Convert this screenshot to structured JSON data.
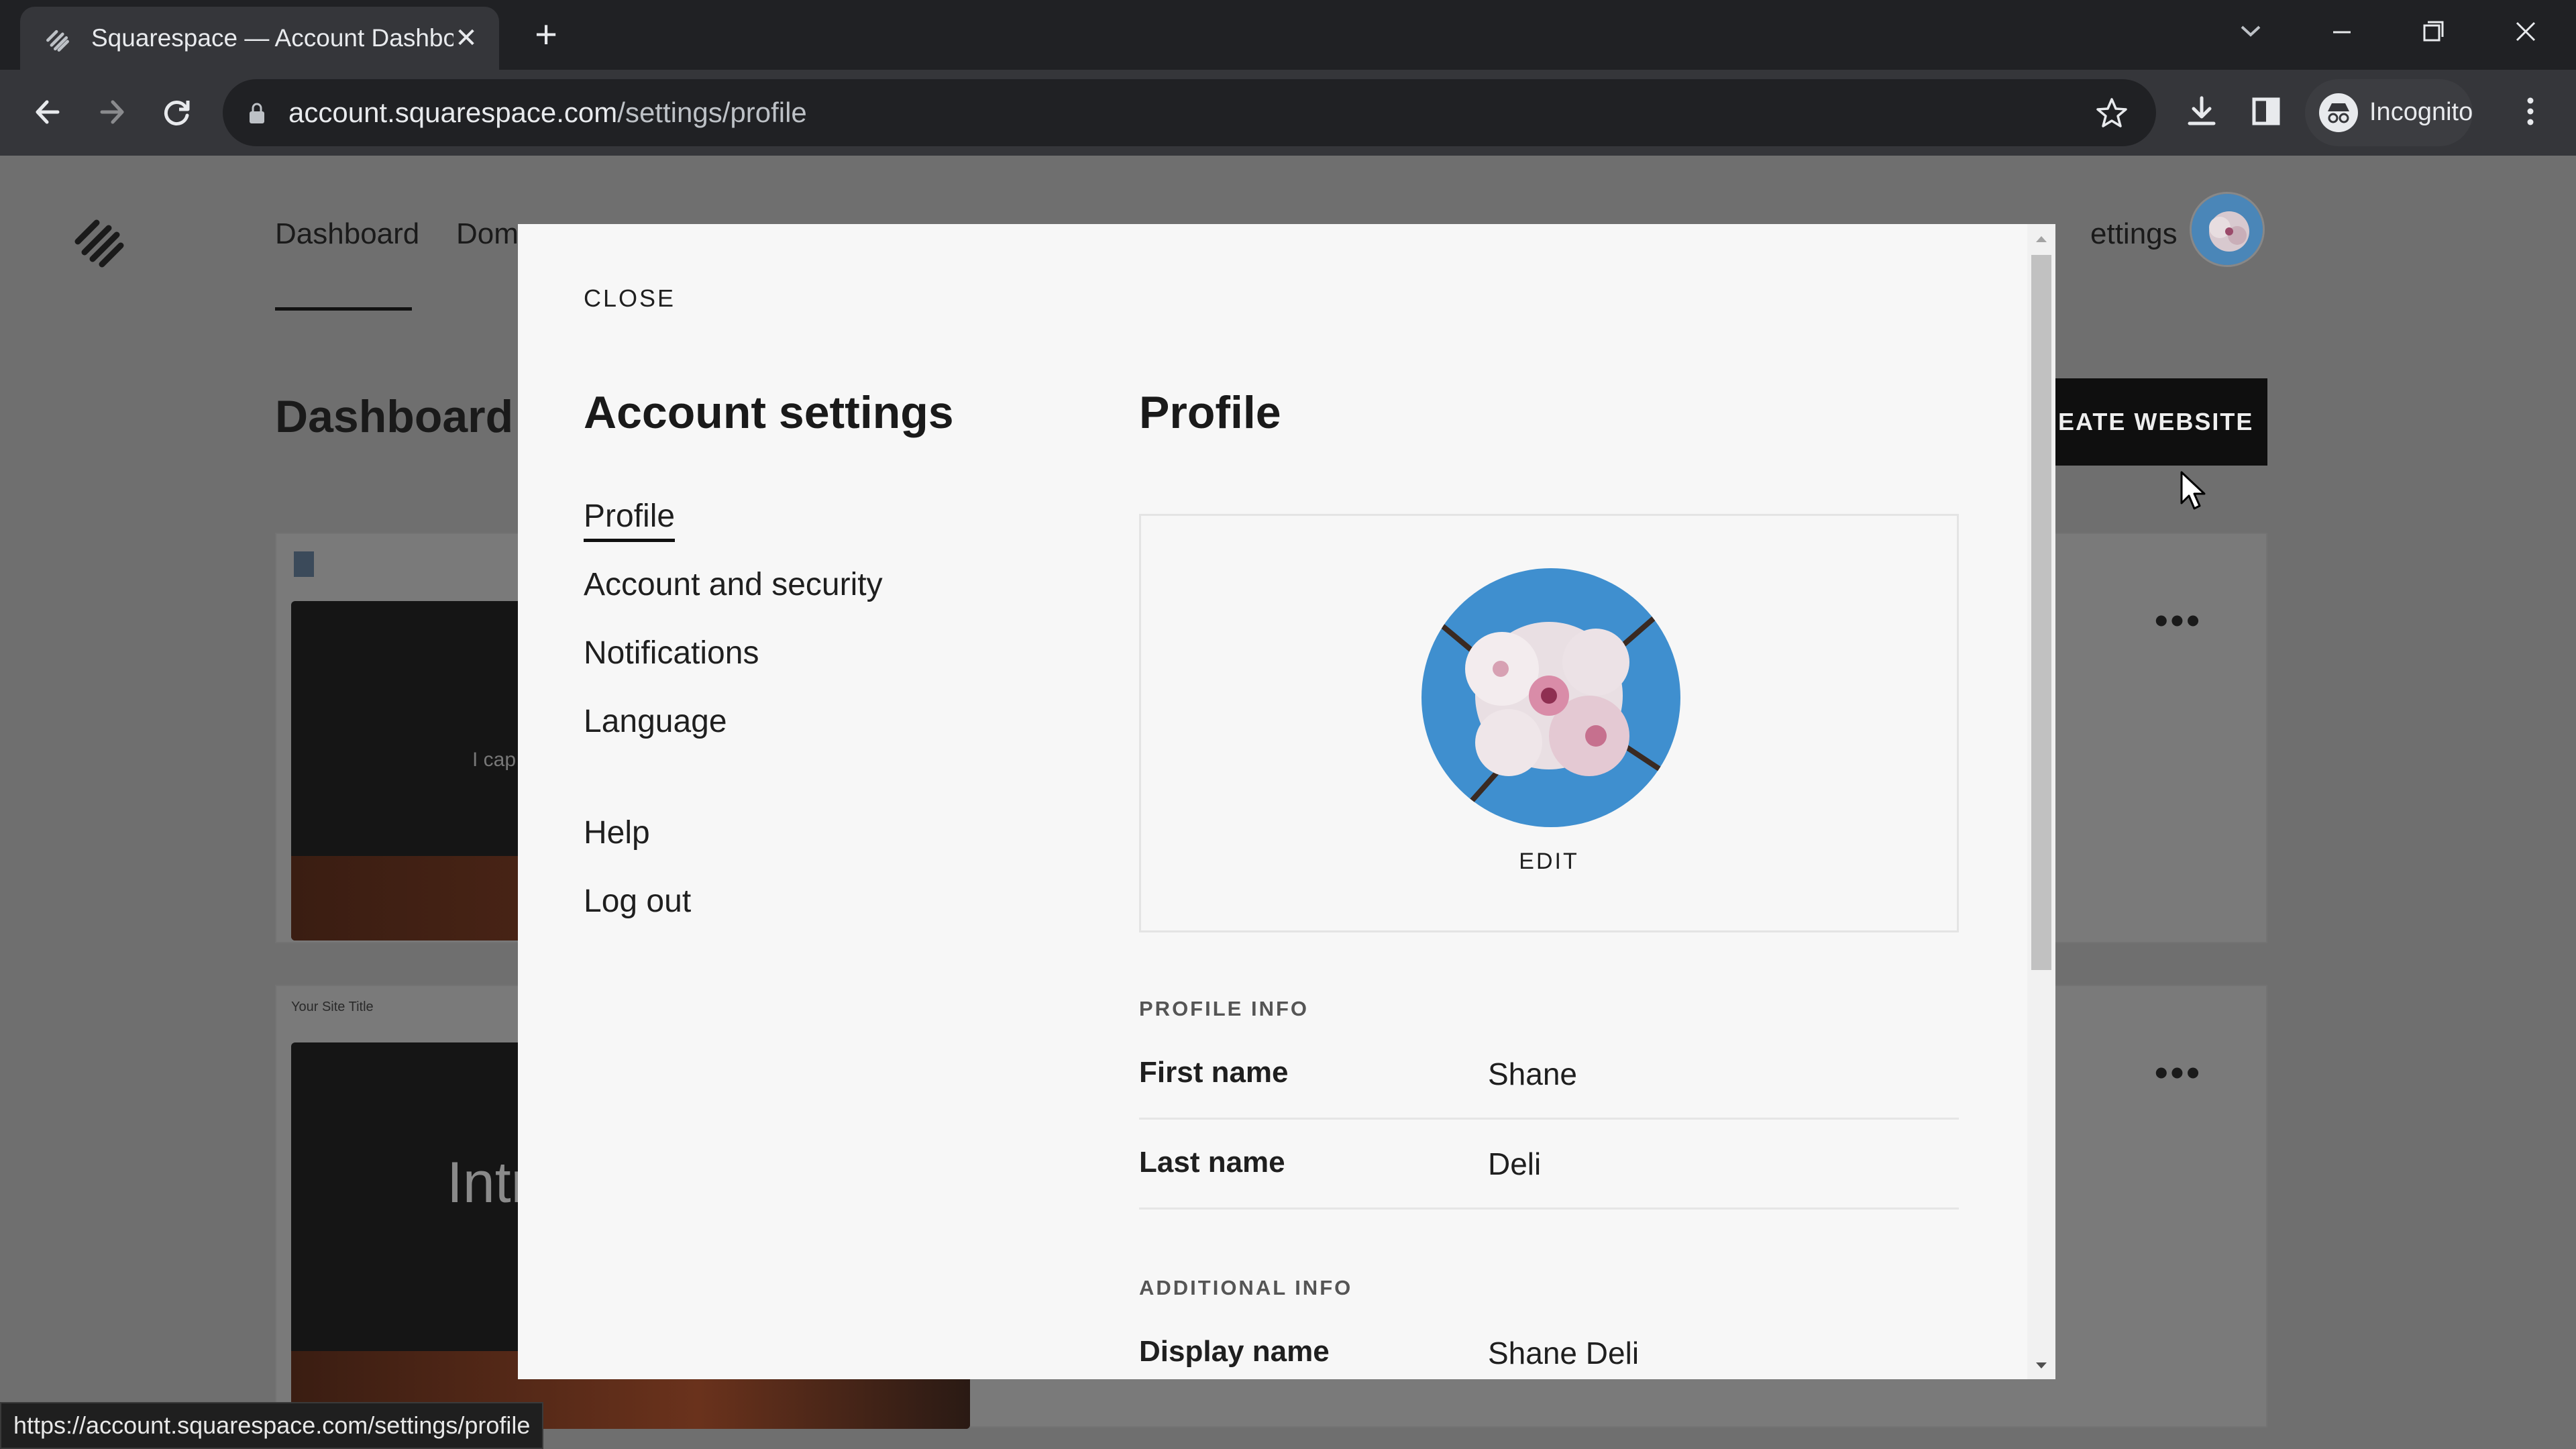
{
  "browser": {
    "tab_title": "Squarespace — Account Dashboard",
    "url_host": "account.squarespace.com",
    "url_path": "/settings/profile",
    "profile_label": "Incognito",
    "status_url": "https://account.squarespace.com/settings/profile"
  },
  "page": {
    "nav": [
      "Dashboard",
      "Domains",
      "Settings"
    ],
    "nav_visible": {
      "dashboard": "Dashboard",
      "domains": "Dom",
      "settings": "ettings"
    },
    "title": "Dashboard",
    "create_button": "EATE WEBSITE",
    "card1_snippet": "I cap",
    "card2_site_title": "Your Site Title",
    "card2_intro": "Intr"
  },
  "modal": {
    "close_label": "CLOSE",
    "heading": "Account settings",
    "menu": [
      {
        "label": "Profile",
        "active": true
      },
      {
        "label": "Account and security",
        "active": false
      },
      {
        "label": "Notifications",
        "active": false
      },
      {
        "label": "Language",
        "active": false
      },
      {
        "label": "Help",
        "active": false
      },
      {
        "label": "Log out",
        "active": false
      }
    ],
    "profile": {
      "heading": "Profile",
      "edit_label": "EDIT",
      "section_profile_info": "PROFILE INFO",
      "first_name_label": "First name",
      "first_name": "Shane",
      "last_name_label": "Last name",
      "last_name": "Deli",
      "section_additional_info": "ADDITIONAL INFO",
      "display_name_label": "Display name",
      "display_name": "Shane Deli"
    }
  },
  "colors": {
    "accent": "#111111",
    "modal_bg": "#f7f7f7",
    "overlay": "#6f6f6f"
  }
}
